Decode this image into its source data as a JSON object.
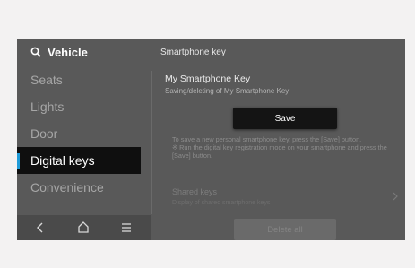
{
  "menu": {
    "title": "Vehicle",
    "items": [
      {
        "label": "Seats"
      },
      {
        "label": "Lights"
      },
      {
        "label": "Door"
      },
      {
        "label": "Digital keys",
        "active": true
      },
      {
        "label": "Convenience"
      }
    ]
  },
  "nav": {
    "icons": [
      "back-icon",
      "home-icon",
      "menu-icon"
    ]
  },
  "pane": {
    "title": "Smartphone key",
    "section_title": "My Smartphone Key",
    "section_subtitle": "Saving/deleting of My Smartphone Key",
    "save_label": "Save",
    "info_line1": "To save a new personal smartphone key, press the [Save] button.",
    "info_line2": "※ Run the digital key registration mode on your smartphone and press the [Save] button.",
    "shared_title": "Shared keys",
    "shared_subtitle": "Display of shared smartphone keys",
    "delete_label": "Delete all"
  },
  "colors": {
    "accent": "#1f9bd8",
    "background": "#595959",
    "active_item": "#0f0f0f"
  }
}
